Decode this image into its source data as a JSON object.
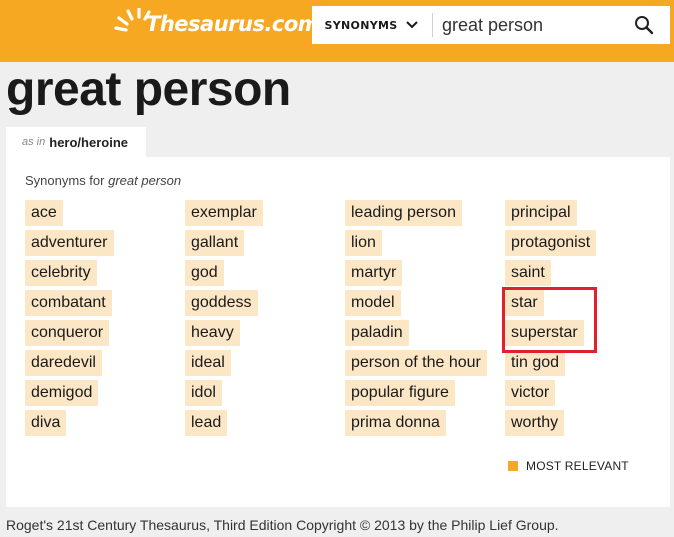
{
  "header": {
    "logo_text": "Thesaurus.com",
    "search": {
      "mode_label": "SYNONYMS",
      "query": "great person"
    },
    "colors": {
      "brand": "#f7a823",
      "chip": "#fbe6c6",
      "highlight": "#e0202f"
    }
  },
  "page_title": "great person",
  "tab": {
    "prefix": "as in",
    "label": "hero/heroine"
  },
  "panel": {
    "heading_prefix": "Synonyms for",
    "heading_term": "great person",
    "columns": [
      [
        "ace",
        "adventurer",
        "celebrity",
        "combatant",
        "conqueror",
        "daredevil",
        "demigod",
        "diva"
      ],
      [
        "exemplar",
        "gallant",
        "god",
        "goddess",
        "heavy",
        "ideal",
        "idol",
        "lead"
      ],
      [
        "leading person",
        "lion",
        "martyr",
        "model",
        "paladin",
        "person of the hour",
        "popular figure",
        "prima donna"
      ],
      [
        "principal",
        "protagonist",
        "saint",
        "star",
        "superstar",
        "tin god",
        "victor",
        "worthy"
      ]
    ],
    "highlighted_words": [
      "star",
      "superstar"
    ],
    "legend_label": "MOST RELEVANT"
  },
  "footer_text": "Roget's 21st Century Thesaurus, Third Edition Copyright © 2013 by the Philip Lief Group."
}
